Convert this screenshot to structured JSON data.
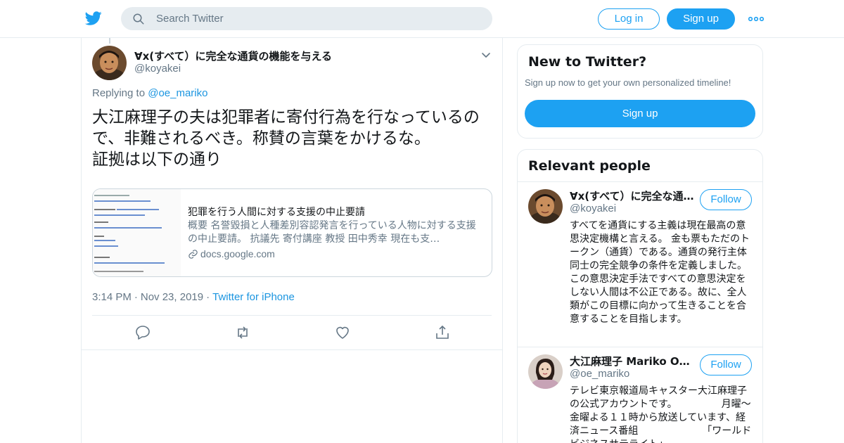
{
  "header": {
    "search_placeholder": "Search Twitter",
    "login_label": "Log in",
    "signup_label": "Sign up",
    "brand_color": "#1da1f2",
    "logo_icon": "twitter-bird-icon",
    "more_icon": "more-dots-icon"
  },
  "tweet": {
    "author_name": "∀x(すべて）に完全な通貨の機能を与える",
    "author_handle": "@koyakei",
    "replying_prefix": "Replying to",
    "replying_to": "@oe_mariko",
    "text_lines": [
      "大江麻理子の夫は犯罪者に寄付行為を行なっているの",
      "で、非難されるべき。称賛の言葉をかけるな。",
      "証拠は以下の通り"
    ],
    "card": {
      "title": "犯罪を行う人間に対する支援の中止要請",
      "description": "概要 名誉毀損と人種差別容認発言を行っている人物に対する支援の中止要請。 抗議先 寄付講座 教授 田中秀幸 現在も支…",
      "domain": "docs.google.com"
    },
    "time": "3:14 PM",
    "date": "Nov 23, 2019",
    "source": "Twitter for iPhone",
    "actions": [
      "reply-icon",
      "retweet-icon",
      "like-icon",
      "share-icon"
    ]
  },
  "new_to_twitter": {
    "title": "New to Twitter?",
    "subtitle": "Sign up now to get your own personalized timeline!",
    "button_label": "Sign up"
  },
  "relevant": {
    "title": "Relevant people",
    "people": [
      {
        "name": "∀x(すべて）に完全な通…",
        "handle": "@koyakei",
        "follow_label": "Follow",
        "bio": "すべてを通貨にする主義は現在最高の意思決定機構と言える。 金も票もただのトークン（通貨）である。通貨の発行主体同士の完全競争の条件を定義しました。この意思決定手法ですべての意思決定をしない人間は不公正である。故に、全人類がこの目標に向かって生きることを合意することを目指します。"
      },
      {
        "name": "大江麻理子 Mariko Oe",
        "handle": "@oe_mariko",
        "follow_label": "Follow",
        "verified": true,
        "bio": "テレビ東京報道局キャスター大江麻理子の公式アカウントです。　　　　　月曜～金曜よる１１時から放送しています、経済ニュース番組　　　　　　　「ワールドビジネスサテライト」"
      }
    ]
  }
}
